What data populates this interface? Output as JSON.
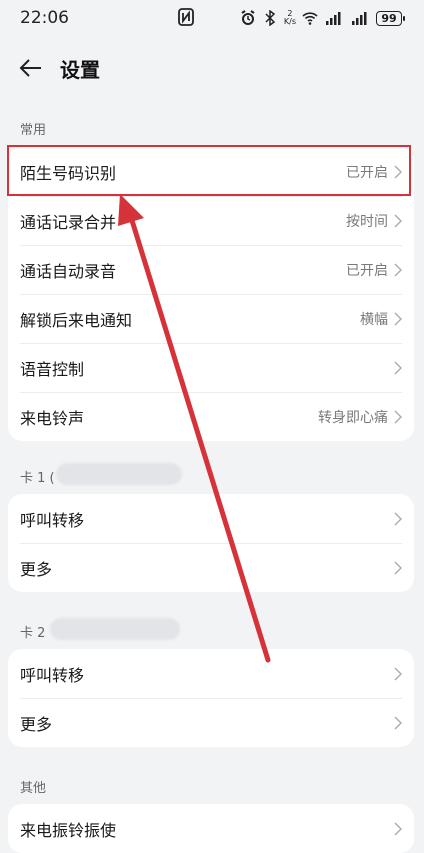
{
  "status": {
    "time": "22:06",
    "net_speed_top": "2",
    "net_speed_bottom": "K/s",
    "battery": "99"
  },
  "header": {
    "title": "设置"
  },
  "sections": {
    "common": {
      "label": "常用",
      "items": [
        {
          "label": "陌生号码识别",
          "value": "已开启"
        },
        {
          "label": "通话记录合并",
          "value": "按时间"
        },
        {
          "label": "通话自动录音",
          "value": "已开启"
        },
        {
          "label": "解锁后来电通知",
          "value": "横幅"
        },
        {
          "label": "语音控制",
          "value": ""
        },
        {
          "label": "来电铃声",
          "value": "转身即心痛"
        }
      ]
    },
    "card1": {
      "label": "卡 1 (",
      "items": [
        {
          "label": "呼叫转移"
        },
        {
          "label": "更多"
        }
      ]
    },
    "card2": {
      "label": "卡 2",
      "items": [
        {
          "label": "呼叫转移"
        },
        {
          "label": "更多"
        }
      ]
    },
    "other": {
      "label": "其他",
      "items": [
        {
          "label": "来电振铃振使"
        }
      ]
    }
  },
  "colors": {
    "annotation": "#d6323a",
    "background": "#f1f3f5"
  }
}
